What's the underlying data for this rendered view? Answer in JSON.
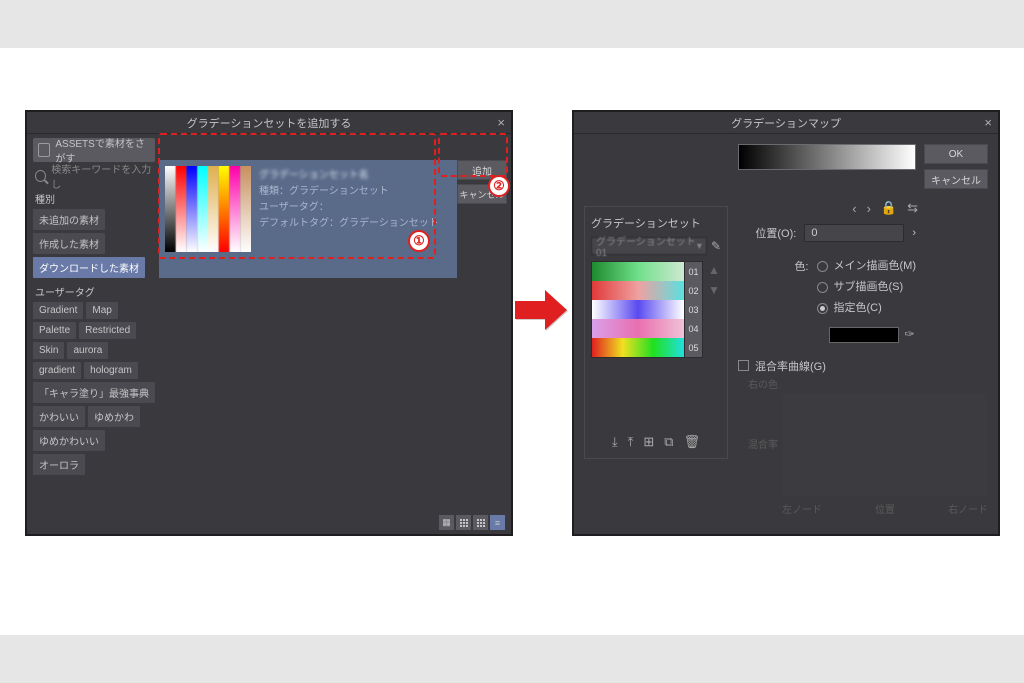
{
  "left": {
    "title": "グラデーションセットを追加する",
    "assets_label": "ASSETSで素材をさがす",
    "search_placeholder": "検索キーワードを入力し",
    "sections": {
      "kind": {
        "label": "種別",
        "items": [
          "未追加の素材",
          "作成した素材",
          "ダウンロードした素材"
        ],
        "selected": 2
      },
      "user_tag": {
        "label": "ユーザータグ",
        "items": [
          "Gradient",
          "Map",
          "Palette",
          "Restricted",
          "Skin",
          "aurora",
          "gradient",
          "hologram",
          "「キャラ塗り」最強事典",
          "かわいい",
          "ゆめかわ",
          "ゆめかわいい",
          "オーロラ"
        ]
      }
    },
    "preview": {
      "title_blur": "グラデーションセット名",
      "lines": [
        "種類：グラデーションセット",
        "ユーザータグ：",
        "デフォルトタグ：グラデーションセット"
      ]
    },
    "buttons": {
      "add": "追加",
      "cancel": "キャンセル"
    }
  },
  "right": {
    "title": "グラデーションマップ",
    "ok": "OK",
    "cancel": "キャンセル",
    "position_label": "位置(O):",
    "position_value": "0",
    "color_label": "色:",
    "radios": {
      "main": "メイン描画色(M)",
      "sub": "サブ描画色(S)",
      "spec": "指定色(C)",
      "selected": "spec"
    },
    "mix_label": "混合率曲線(G)",
    "axis": {
      "left": "右の色",
      "mid": "混合率",
      "bottom_left": "左ノード",
      "bottom_center": "位置",
      "bottom_right": "右ノード"
    },
    "set": {
      "label": "グラデーションセット",
      "dropdown": "グラデーションセット01",
      "strips": [
        {
          "num": "01",
          "g": "linear-gradient(to right,#1d8a2d,#6fe08a,#cfe8d2)"
        },
        {
          "num": "02",
          "g": "linear-gradient(to right,#e03a3a,#f0a0a0,#5be0e0)"
        },
        {
          "num": "03",
          "g": "linear-gradient(to right,#ffffff,#5a4af0,#ffffff)"
        },
        {
          "num": "04",
          "g": "linear-gradient(to right,#d8a0e8,#e96fb0,#f0c2d6)"
        },
        {
          "num": "05",
          "g": "linear-gradient(to right,#e02020,#f0e020,#20e020,#20e0e0)"
        }
      ]
    }
  },
  "badges": {
    "one": "①",
    "two": "②"
  }
}
